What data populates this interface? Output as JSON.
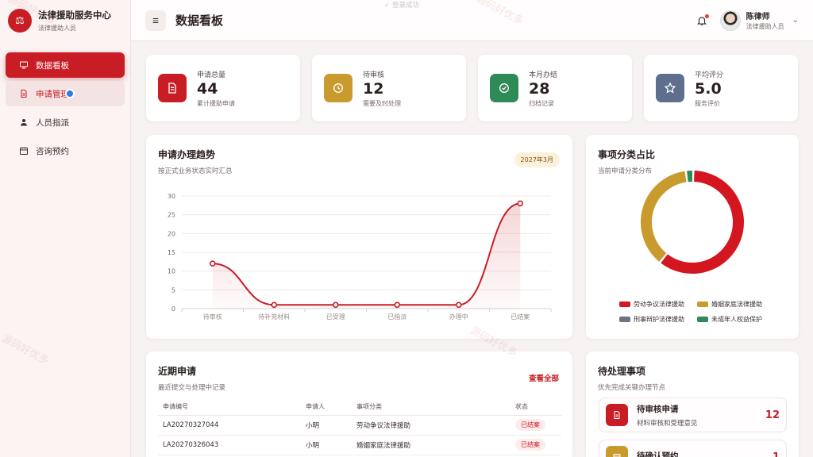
{
  "brand": {
    "title": "法律援助服务中心",
    "subtitle": "法律援助人员",
    "logo_icon": "scales-icon"
  },
  "sidebar": {
    "items": [
      {
        "label": "数据看板",
        "icon": "monitor-icon",
        "state": "active"
      },
      {
        "label": "申请管理",
        "icon": "file-icon",
        "state": "hover"
      },
      {
        "label": "人员指派",
        "icon": "user-icon",
        "state": "normal"
      },
      {
        "label": "咨询预约",
        "icon": "calendar-icon",
        "state": "normal"
      }
    ]
  },
  "header": {
    "title": "数据看板",
    "top_hint": "登录成功",
    "user": {
      "name": "陈律师",
      "role": "法律援助人员"
    }
  },
  "stats": [
    {
      "label": "申请总量",
      "value": "44",
      "note": "累计援助申请",
      "color": "#c81d25",
      "icon": "document-icon"
    },
    {
      "label": "待审核",
      "value": "12",
      "note": "需要及时处理",
      "color": "#c99a2e",
      "icon": "clock-icon"
    },
    {
      "label": "本月办结",
      "value": "28",
      "note": "归档记录",
      "color": "#2e8a57",
      "icon": "check-circle-icon"
    },
    {
      "label": "平均评分",
      "value": "5.0",
      "note": "服务评价",
      "color": "#5d6e8f",
      "icon": "star-icon"
    }
  ],
  "trend": {
    "title": "申请办理趋势",
    "subtitle": "按正式业务状态实时汇总",
    "badge": "2027年3月"
  },
  "chart_data": [
    {
      "type": "line",
      "categories": [
        "待审核",
        "待补充材料",
        "已受理",
        "已指派",
        "办理中",
        "已结案"
      ],
      "values": [
        12,
        1,
        1,
        1,
        1,
        28
      ],
      "ylim": [
        0,
        30
      ],
      "yticks": [
        0,
        5,
        10,
        15,
        20,
        25,
        30
      ],
      "grid": true,
      "color": "#c81d25"
    },
    {
      "type": "pie",
      "categories": [
        "劳动争议法律援助",
        "婚姻家庭法律援助",
        "刑事辩护法律援助",
        "未成年人权益保护"
      ],
      "values": [
        26,
        16,
        0,
        1
      ],
      "colors": [
        "#d3161f",
        "#c99a2e",
        "#6b7485",
        "#2e8a57"
      ],
      "legend": "bottom"
    }
  ],
  "category": {
    "title": "事项分类占比",
    "subtitle": "当前申请分类分布"
  },
  "recent": {
    "title": "近期申请",
    "subtitle": "最近提交与处理中记录",
    "link": "查看全部",
    "columns": [
      "申请编号",
      "申请人",
      "事项分类",
      "状态"
    ],
    "rows": [
      [
        "LA20270327044",
        "小明",
        "劳动争议法律援助",
        "已结案"
      ],
      [
        "LA20270326043",
        "小明",
        "婚姻家庭法律援助",
        "已结案"
      ]
    ]
  },
  "todo": {
    "title": "待处理事项",
    "subtitle": "优先完成关键办理节点",
    "items": [
      {
        "title": "待审核申请",
        "sub": "材料审核和受理意见",
        "count": "12",
        "color": "#c81d25",
        "icon": "document-icon"
      },
      {
        "title": "待确认预约",
        "sub": "",
        "count": "1",
        "color": "#c99a2e",
        "icon": "calendar-icon"
      }
    ]
  },
  "watermark": "源码好优多"
}
